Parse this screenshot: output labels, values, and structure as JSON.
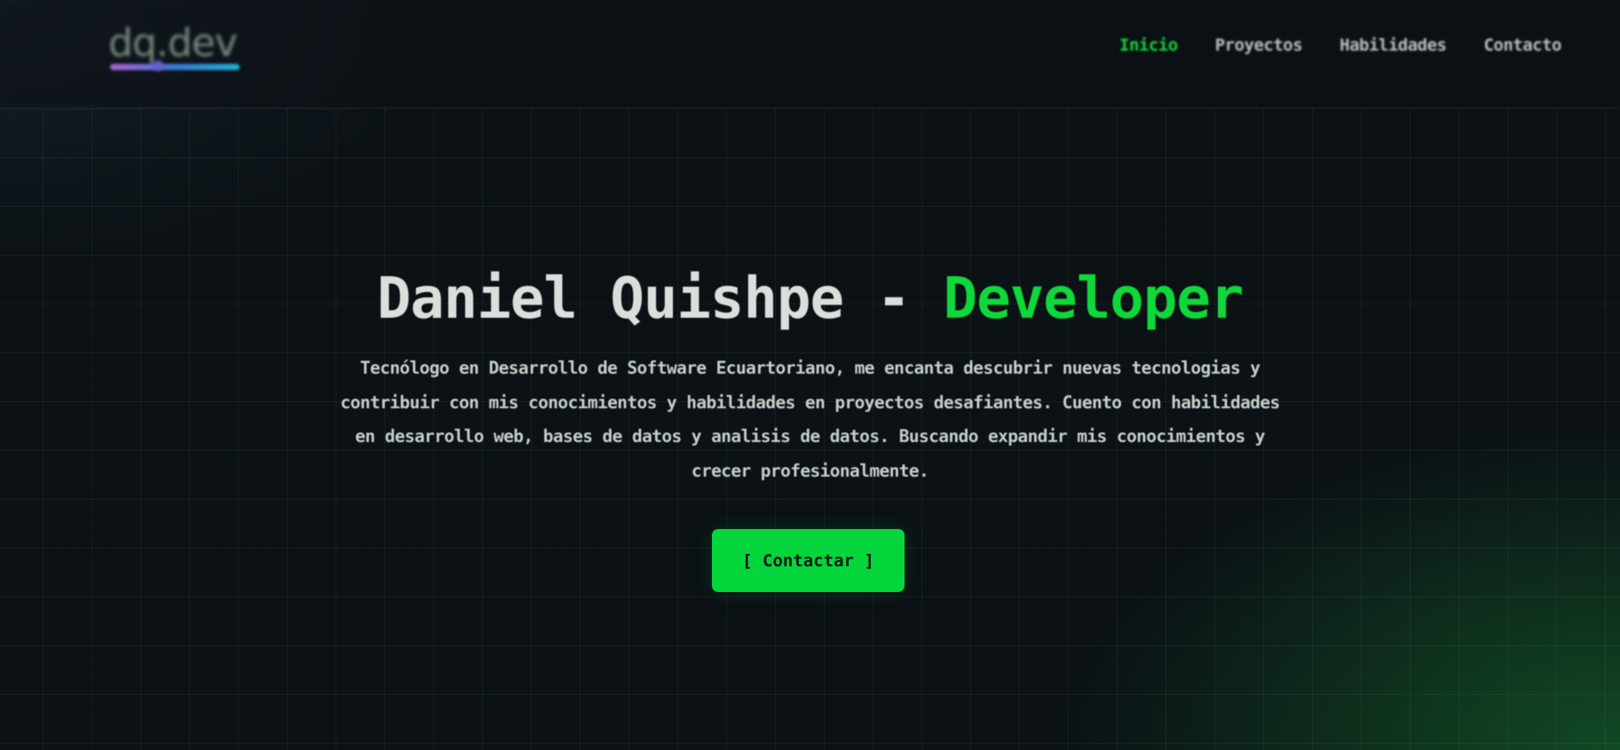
{
  "header": {
    "logo": {
      "text": "dq.dev",
      "gradient_colors": [
        "#b261d8",
        "#3a7ad8",
        "#1fb5d8"
      ]
    },
    "nav": [
      {
        "label": "Inicio",
        "active": true
      },
      {
        "label": "Proyectos",
        "active": false
      },
      {
        "label": "Habilidades",
        "active": false
      },
      {
        "label": "Contacto",
        "active": false
      }
    ]
  },
  "hero": {
    "title_main": "Daniel Quishpe - ",
    "title_accent": "Developer",
    "description": "Tecnólogo en Desarrollo de Software Ecuartoriano, me encanta descubrir nuevas tecnologias y contribuir con mis conocimientos y habilidades en proyectos desafiantes. Cuento con habilidades en desarrollo web, bases de datos y analisis de datos. Buscando expandir mis conocimientos y crecer profesionalmente.",
    "cta_label": "[ Contactar ]"
  },
  "colors": {
    "accent": "#04d53a",
    "background": "#0b1115",
    "text": "#d9e0dc"
  }
}
